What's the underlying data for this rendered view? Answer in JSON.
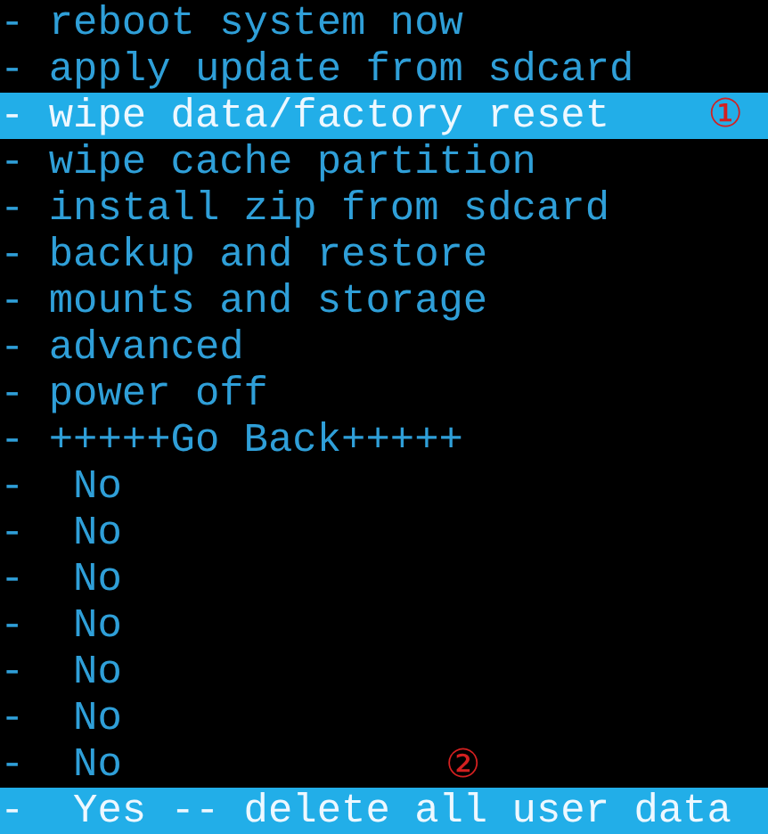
{
  "menu": [
    {
      "text": "- reboot system now",
      "selected": false
    },
    {
      "text": "- apply update from sdcard",
      "selected": false
    },
    {
      "text": "- wipe data/factory reset",
      "selected": true,
      "marker": "①"
    },
    {
      "text": "- wipe cache partition",
      "selected": false
    },
    {
      "text": "- install zip from sdcard",
      "selected": false
    },
    {
      "text": "- backup and restore",
      "selected": false
    },
    {
      "text": "- mounts and storage",
      "selected": false
    },
    {
      "text": "- advanced",
      "selected": false
    },
    {
      "text": "- power off",
      "selected": false
    },
    {
      "text": "- +++++Go Back+++++",
      "selected": false
    },
    {
      "text": "-  No",
      "selected": false
    },
    {
      "text": "-  No",
      "selected": false
    },
    {
      "text": "-  No",
      "selected": false
    },
    {
      "text": "-  No",
      "selected": false
    },
    {
      "text": "-  No",
      "selected": false
    },
    {
      "text": "-  No",
      "selected": false
    },
    {
      "text": "-  No",
      "selected": false,
      "marker": "②"
    },
    {
      "text": "-  Yes -- delete all user data",
      "selected": true
    }
  ]
}
